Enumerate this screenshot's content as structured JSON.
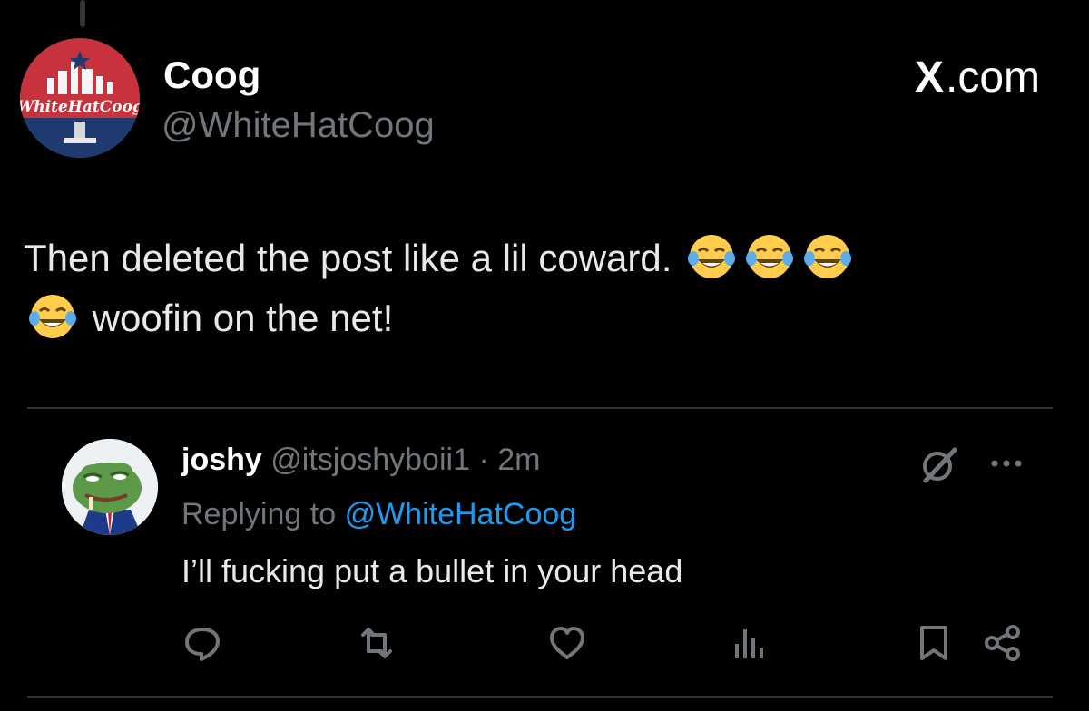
{
  "author": {
    "name": "Coog",
    "handle": "@WhiteHatCoog",
    "avatar_text": "WhiteHatCoog"
  },
  "site": {
    "x_mark": "X",
    "suffix": ".com"
  },
  "post": {
    "line1": "Then deleted the post like a lil coward.",
    "line2": "woofin on the net!",
    "emoji_icon": "face-with-tears-of-joy-icon"
  },
  "reply": {
    "name": "joshy",
    "handle": "@itsjoshyboii1",
    "separator": "·",
    "time": "2m",
    "replying_to_label": "Replying to",
    "replying_to_handle": "@WhiteHatCoog",
    "text": "I’ll fucking put a bullet in your head"
  },
  "colors": {
    "background": "#000000",
    "text": "#e7e9ea",
    "muted": "#71767b",
    "link": "#1d9bf0",
    "divider": "#2f3336"
  },
  "actions": [
    "reply-icon",
    "retweet-icon",
    "like-icon",
    "views-icon",
    "bookmark-icon",
    "share-icon"
  ]
}
